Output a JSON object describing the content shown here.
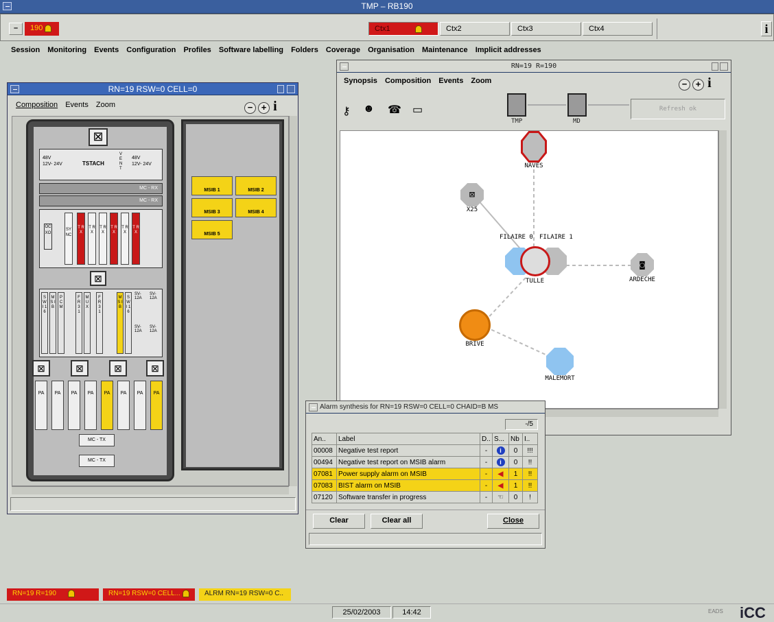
{
  "window": {
    "title": "TMP – RB190"
  },
  "top": {
    "id_label": "190",
    "contexts": [
      "Ctx1",
      "Ctx2",
      "Ctx3",
      "Ctx4"
    ],
    "info": "i"
  },
  "menu": [
    "Session",
    "Monitoring",
    "Events",
    "Configuration",
    "Profiles",
    "Software labelling",
    "Folders",
    "Coverage",
    "Organisation",
    "Maintenance",
    "Implicit addresses"
  ],
  "rack_window": {
    "title": "RN=19 RSW=0 CELL=0",
    "menu": [
      "Composition",
      "Events",
      "Zoom"
    ],
    "modules": {
      "psu": [
        "48V",
        "12V- 24V",
        "TSTACH",
        "V E N T",
        "48V",
        "12V- 24V"
      ],
      "mcrx": [
        "MC - RX",
        "MC - RX"
      ],
      "ocxo": "OCXO",
      "sync": "SYNC",
      "trx": [
        "T R X",
        "T R X",
        "T R X",
        "T R X",
        "T R X",
        "T R X"
      ],
      "bottom": [
        "S W I 1 6",
        "M S I B",
        "P C M",
        "F R 3 1",
        "M U X",
        "F R 3 1",
        "M S I B",
        "S W I 1 6"
      ],
      "sv": [
        "SV-12A",
        "SV-12A",
        "SV-12A",
        "SV-12A"
      ],
      "pa": [
        "PA",
        "PA",
        "PA",
        "PA",
        "PA",
        "PA",
        "PA",
        "PA"
      ],
      "mctx": [
        "MC - TX",
        "MC - TX"
      ]
    },
    "msib": [
      "MSIB 1",
      "MSIB 2",
      "MSIB 3",
      "MSIB 4",
      "MSIB 5"
    ]
  },
  "net_window": {
    "title": "RN=19 R=190",
    "menu": [
      "Synopsis",
      "Composition",
      "Events",
      "Zoom"
    ],
    "hosts": [
      "TMP",
      "MD"
    ],
    "refresh": "Refresh ok",
    "nodes": {
      "naves": "NAVES",
      "x25": "X25",
      "filaire0": "FILAIRE 0",
      "filaire1": "FILAIRE 1",
      "tulle": "TULLE",
      "ardeche": "ARDECHE",
      "brive": "BRIVE",
      "malemort": "MALEMORT"
    }
  },
  "alarm_window": {
    "title": "Alarm synthesis for RN=19 RSW=0 CELL=0 CHAID=B MS",
    "counter": "-/5",
    "columns": [
      "An..",
      "Label",
      "D..",
      "S...",
      "Nb",
      "I.."
    ],
    "rows": [
      {
        "code": "00008",
        "label": "Negative test report",
        "d": "-",
        "nb": "0",
        "i": "!!!",
        "sev": "info",
        "hl": false
      },
      {
        "code": "00494",
        "label": "Negative test report on MSIB alarm",
        "d": "-",
        "nb": "0",
        "i": "!!",
        "sev": "info",
        "hl": false
      },
      {
        "code": "07081",
        "label": "Power supply alarm on MSIB",
        "d": "-",
        "nb": "1",
        "i": "!!",
        "sev": "speaker",
        "hl": true
      },
      {
        "code": "07083",
        "label": "BIST alarm on MSIB",
        "d": "-",
        "nb": "1",
        "i": "!!",
        "sev": "speaker",
        "hl": true
      },
      {
        "code": "07120",
        "label": "Software transfer in progress",
        "d": "-",
        "nb": "0",
        "i": "!",
        "sev": "hand",
        "hl": false
      }
    ],
    "buttons": {
      "clear": "Clear",
      "clear_all": "Clear all",
      "close": "Close"
    }
  },
  "taskbar": {
    "items": [
      "RN=19 R=190",
      "RN=19 RSW=0 CELL...",
      "ALRM RN=19 RSW=0 C.."
    ]
  },
  "status": {
    "date": "25/02/2003",
    "time": "14:42",
    "brand_small": "EADS",
    "brand": "iCC"
  },
  "colors": {
    "alarm_red": "#d01818",
    "warning_yellow": "#f4d317",
    "title_blue": "#2f5aa8",
    "link_gray": "#b8b8b8"
  }
}
